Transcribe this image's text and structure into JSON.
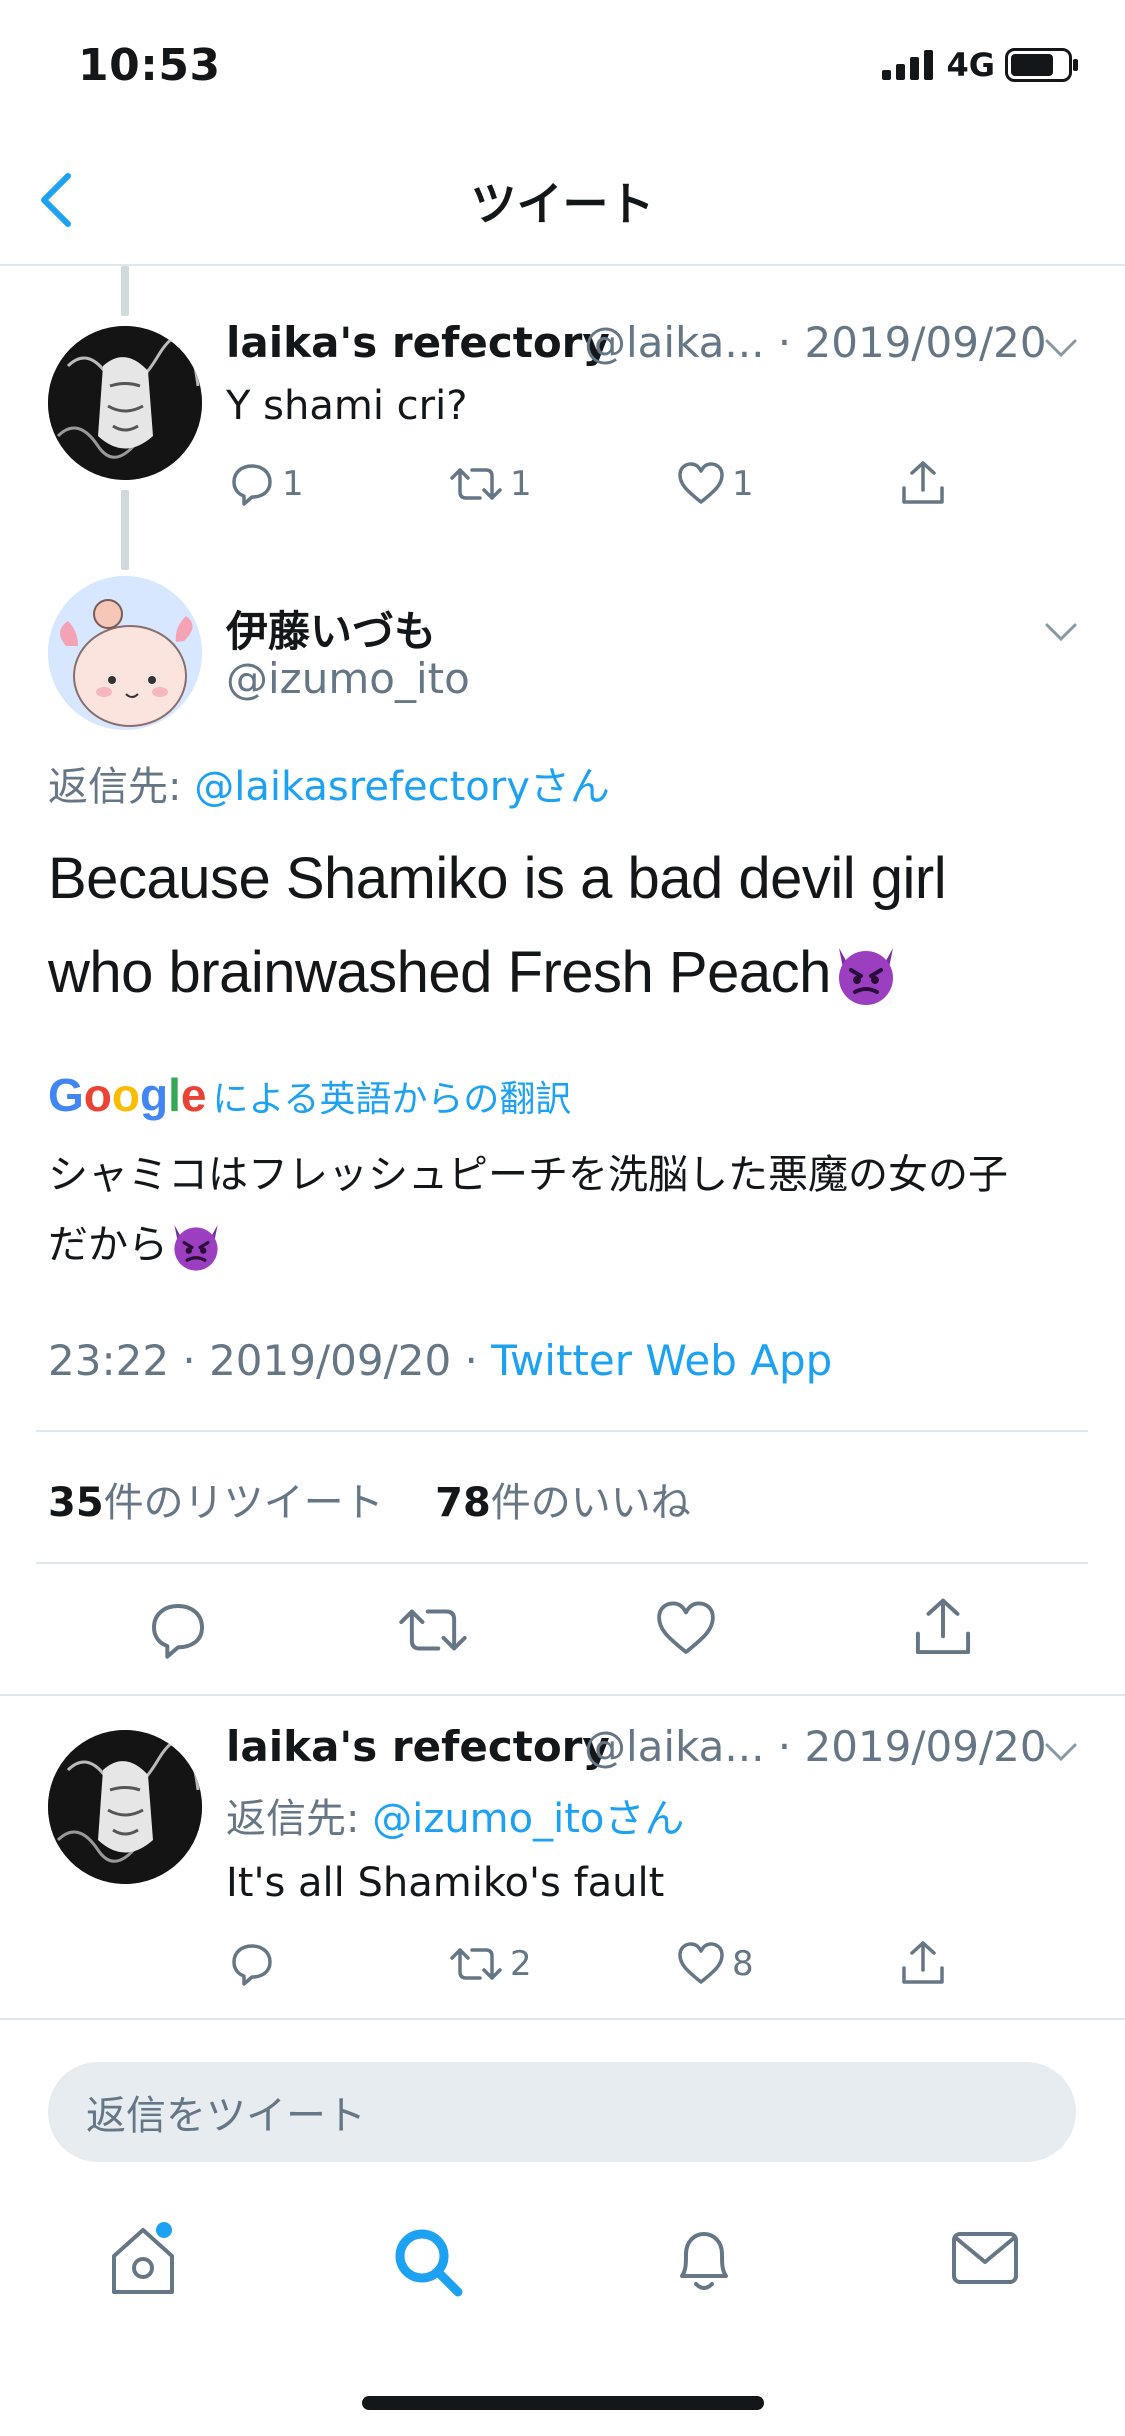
{
  "status_bar": {
    "time": "10:53",
    "network": "4G"
  },
  "nav": {
    "title": "ツイート"
  },
  "reply1": {
    "name": "laika's refectory",
    "handle_date": "@laika... · 2019/09/20",
    "text": "Y shami cri?",
    "counts": {
      "reply": "1",
      "retweet": "1",
      "like": "1"
    }
  },
  "main": {
    "name": "伊藤いづも",
    "handle": "@izumo_ito",
    "reply_to_prefix": "返信先: ",
    "reply_to_user": "@laikasrefectoryさん",
    "text_line1": "Because Shamiko is a bad devil girl",
    "text_line2": "who brainwashed Fresh Peach",
    "translate_brand": "Google",
    "translate_label": "による英語からの翻訳",
    "translation_line1": "シャミコはフレッシュピーチを洗脳した悪魔の女の子",
    "translation_line2": "だから",
    "timestamp": "23:22 · 2019/09/20 · ",
    "source": "Twitter Web App",
    "retweet_count": "35",
    "retweet_label": "件のリツイート",
    "like_count": "78",
    "like_label": "件のいいね"
  },
  "reply2": {
    "name": "laika's refectory",
    "handle_date": "@laika... · 2019/09/20",
    "reply_to_prefix": "返信先: ",
    "reply_to_user": "@izumo_itoさん",
    "text": "It's all Shamiko's fault",
    "counts": {
      "reply": "",
      "retweet": "2",
      "like": "8"
    }
  },
  "composer": {
    "placeholder": "返信をツイート"
  },
  "colors": {
    "accent": "#1da1f2",
    "muted": "#657786",
    "divider": "#e1e8ed"
  }
}
